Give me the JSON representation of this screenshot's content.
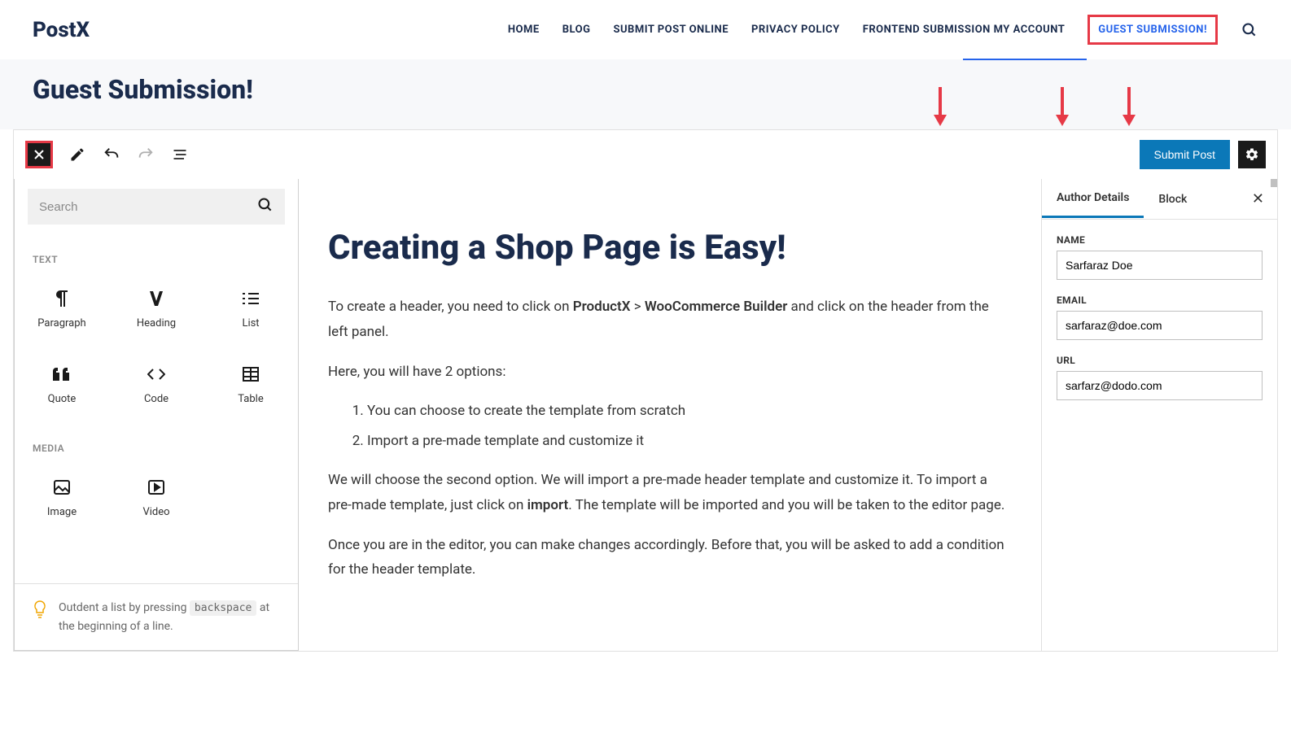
{
  "site": {
    "logo": "PostX"
  },
  "nav": {
    "items": [
      "HOME",
      "BLOG",
      "SUBMIT POST ONLINE",
      "PRIVACY POLICY",
      "FRONTEND SUBMISSION MY ACCOUNT",
      "GUEST SUBMISSION!"
    ]
  },
  "page": {
    "title": "Guest Submission!"
  },
  "toolbar": {
    "submit_label": "Submit Post"
  },
  "inserter": {
    "search_placeholder": "Search",
    "sections": {
      "text": {
        "label": "TEXT",
        "blocks": [
          "Paragraph",
          "Heading",
          "List",
          "Quote",
          "Code",
          "Table"
        ]
      },
      "media": {
        "label": "MEDIA",
        "blocks": [
          "Image",
          "Video"
        ]
      }
    },
    "tip": {
      "before": "Outdent a list by pressing ",
      "key": "backspace",
      "after": " at the beginning of a line."
    }
  },
  "post": {
    "title": "Creating a Shop Page is Easy!",
    "p1_before": "To create a header, you need to click on ",
    "p1_bold1": "ProductX",
    "p1_mid": " > ",
    "p1_bold2": "WooCommerce Builder",
    "p1_after": " and click on the header from the left panel.",
    "p2": "Here, you will have 2 options:",
    "li1": "You can choose to create the template from scratch",
    "li2": "Import a pre-made template and customize it",
    "p3_before": "We will choose the second option. We will import a pre-made header template and customize it. To import a pre-made template, just click on ",
    "p3_bold": "import",
    "p3_after": ". The template will be imported and you will be taken to the editor page.",
    "p4": "Once you are in the editor, you can make changes accordingly. Before that, you will be asked to add a condition for the header template."
  },
  "sidebar": {
    "tabs": [
      "Author Details",
      "Block"
    ],
    "fields": {
      "name": {
        "label": "NAME",
        "value": "Sarfaraz Doe"
      },
      "email": {
        "label": "EMAIL",
        "value": "sarfaraz@doe.com"
      },
      "url": {
        "label": "URL",
        "value": "sarfarz@dodo.com"
      }
    }
  }
}
